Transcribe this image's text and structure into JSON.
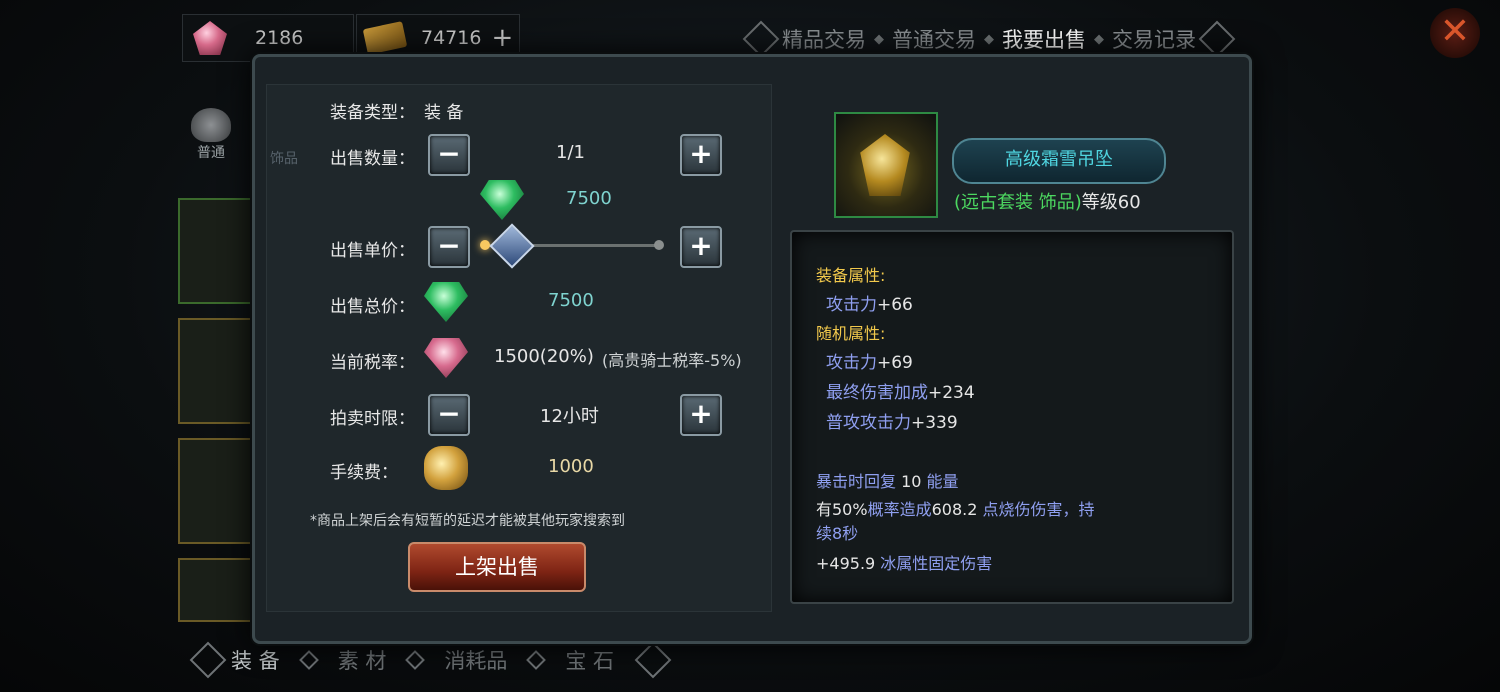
{
  "currency": {
    "diamond": "2186",
    "gold_ticket": "74716",
    "add_icon": "+"
  },
  "top_tabs": {
    "premium_trade": "精品交易",
    "normal_trade": "普通交易",
    "sell": "我要出售",
    "history": "交易记录"
  },
  "close_icon": "✕",
  "sidebar": {
    "cat_normal": "普通",
    "cat_accessory": "饰品"
  },
  "bottom_tabs": {
    "equipment": "装 备",
    "material": "素 材",
    "consumable": "消耗品",
    "gem": "宝 石"
  },
  "sell_form": {
    "type_label": "装备类型：",
    "type_value": "装 备",
    "qty_label": "出售数量：",
    "qty_value": "1/1",
    "unit_price_label": "出售单价：",
    "unit_price_value": "7500",
    "total_label": "出售总价：",
    "total_value": "7500",
    "tax_label": "当前税率：",
    "tax_value": "1500(20%)",
    "tax_note": "(高贵骑士税率-5%)",
    "duration_label": "拍卖时限：",
    "duration_value": "12小时",
    "fee_label": "手续费：",
    "fee_value": "1000",
    "note": "*商品上架后会有短暂的延迟才能被其他玩家搜索到",
    "sell_button": "上架出售",
    "minus": "−",
    "plus": "+"
  },
  "item": {
    "name": "高级霜雪吊坠",
    "set_info": "(远古套装 饰品)",
    "level": "等级60",
    "equip_attr_header": "装备属性:",
    "equip_attr_1_key": "攻击力",
    "equip_attr_1_val": "+66",
    "random_attr_header": "随机属性:",
    "random_attr_1_key": "攻击力",
    "random_attr_1_val": "+69",
    "random_attr_2_key": "最终伤害加成",
    "random_attr_2_val": "+234",
    "random_attr_3_key": "普攻攻击力",
    "random_attr_3_val": "+339",
    "skill_1_key": "暴击时回复",
    "skill_1_val": " 10 ",
    "skill_1_tail": "能量",
    "skill_2_a": "有50%",
    "skill_2_b": "概率造成",
    "skill_2_c": "608.2",
    "skill_2_d": " 点烧伤伤害，持",
    "skill_2_e": "续8秒",
    "skill_3_a": "+495.9",
    "skill_3_b": " 冰属性固定伤害"
  },
  "colors": {
    "name_cyan": "#4fd5e0",
    "set_green": "#4cd860",
    "attr_header": "#f2c94c",
    "attr_key": "#8f9ff0",
    "sell_button": "#8e2c18"
  }
}
